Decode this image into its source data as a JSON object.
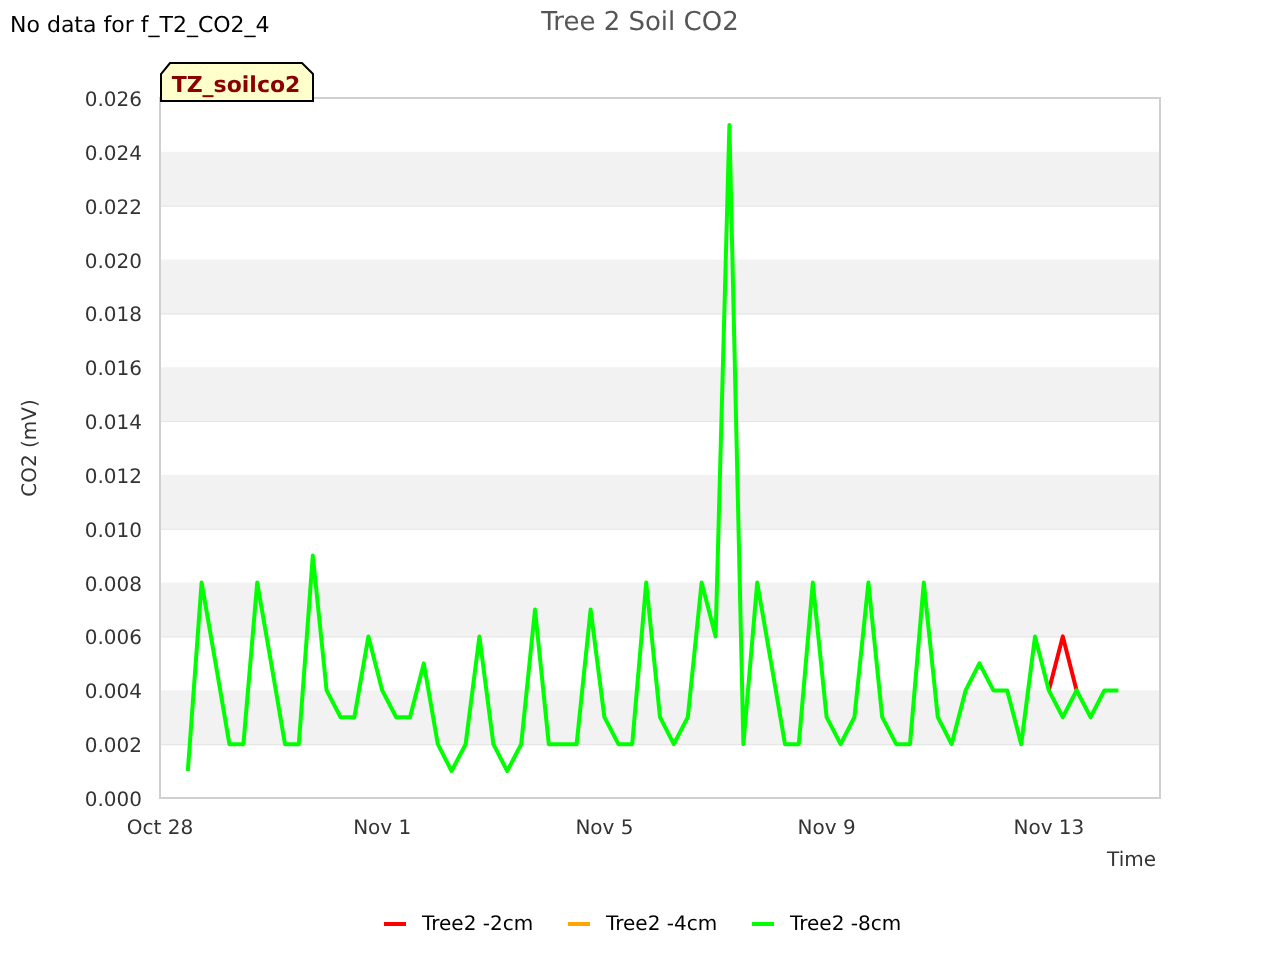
{
  "status_text": "No data for f_T2_CO2_4",
  "chart": {
    "tag": "TZ_soilco2",
    "chart_data": {
      "type": "line",
      "title": "Tree 2 Soil CO2",
      "xlabel": "Time",
      "ylabel": "CO2 (mV)",
      "grid": true,
      "legend": "bottom",
      "ylim": [
        0,
        0.026
      ],
      "yticks": [
        {
          "value": 0,
          "label": "0.000"
        },
        {
          "value": 0.002,
          "label": "0.002"
        },
        {
          "value": 0.004,
          "label": "0.004"
        },
        {
          "value": 0.006,
          "label": "0.006"
        },
        {
          "value": 0.008,
          "label": "0.008"
        },
        {
          "value": 0.01,
          "label": "0.010"
        },
        {
          "value": 0.012,
          "label": "0.012"
        },
        {
          "value": 0.014,
          "label": "0.014"
        },
        {
          "value": 0.016,
          "label": "0.016"
        },
        {
          "value": 0.018,
          "label": "0.018"
        },
        {
          "value": 0.02,
          "label": "0.020"
        },
        {
          "value": 0.022,
          "label": "0.022"
        },
        {
          "value": 0.024,
          "label": "0.024"
        },
        {
          "value": 0.026,
          "label": "0.026"
        }
      ],
      "categories": [
        "Oct 28",
        null,
        null,
        null,
        null,
        null,
        null,
        null,
        null,
        null,
        null,
        null,
        null,
        null,
        null,
        null,
        "Nov 1",
        null,
        null,
        null,
        null,
        null,
        null,
        null,
        null,
        null,
        null,
        null,
        null,
        null,
        null,
        null,
        "Nov 5",
        null,
        null,
        null,
        null,
        null,
        null,
        null,
        null,
        null,
        null,
        null,
        null,
        null,
        null,
        null,
        "Nov 9",
        null,
        null,
        null,
        null,
        null,
        null,
        null,
        null,
        null,
        null,
        null,
        null,
        null,
        null,
        null,
        "Nov 13",
        null,
        null,
        null,
        null,
        null,
        null,
        null,
        null
      ],
      "series": [
        {
          "name": "Tree2 -2cm",
          "color": "#ff0000",
          "values": [
            null,
            null,
            null,
            null,
            null,
            null,
            null,
            null,
            null,
            null,
            null,
            null,
            null,
            null,
            null,
            null,
            null,
            null,
            null,
            null,
            null,
            null,
            null,
            null,
            null,
            null,
            null,
            null,
            null,
            null,
            null,
            null,
            null,
            null,
            null,
            null,
            null,
            null,
            null,
            null,
            null,
            null,
            null,
            null,
            null,
            null,
            null,
            null,
            null,
            null,
            null,
            null,
            null,
            null,
            null,
            null,
            null,
            null,
            null,
            null,
            null,
            null,
            null,
            null,
            0.004,
            0.006,
            0.004,
            null,
            null,
            null,
            null,
            null,
            null
          ]
        },
        {
          "name": "Tree2 -4cm",
          "color": "#ffa500",
          "values": [
            null,
            null,
            null,
            null,
            null,
            null,
            null,
            null,
            null,
            null,
            null,
            null,
            null,
            null,
            null,
            null,
            null,
            null,
            null,
            null,
            null,
            null,
            null,
            null,
            null,
            null,
            null,
            null,
            null,
            null,
            null,
            null,
            null,
            null,
            null,
            null,
            null,
            null,
            null,
            null,
            null,
            null,
            null,
            null,
            null,
            null,
            null,
            null,
            null,
            null,
            null,
            null,
            null,
            null,
            null,
            null,
            null,
            null,
            null,
            null,
            null,
            null,
            null,
            null,
            null,
            null,
            null,
            null,
            null,
            null,
            null,
            null,
            null
          ]
        },
        {
          "name": "Tree2 -8cm",
          "color": "#00ff00",
          "values": [
            null,
            null,
            0.001,
            0.008,
            0.005,
            0.002,
            0.002,
            0.008,
            0.005,
            0.002,
            0.002,
            0.009,
            0.004,
            0.003,
            0.003,
            0.006,
            0.004,
            0.003,
            0.003,
            0.005,
            0.002,
            0.001,
            0.002,
            0.006,
            0.002,
            0.001,
            0.002,
            0.007,
            0.002,
            0.002,
            0.002,
            0.007,
            0.003,
            0.002,
            0.002,
            0.008,
            0.003,
            0.002,
            0.003,
            0.008,
            0.006,
            0.025,
            0.002,
            0.008,
            0.005,
            0.002,
            0.002,
            0.008,
            0.003,
            0.002,
            0.003,
            0.008,
            0.003,
            0.002,
            0.002,
            0.008,
            0.003,
            0.002,
            0.004,
            0.005,
            0.004,
            0.004,
            0.002,
            0.006,
            0.004,
            0.003,
            0.004,
            0.003,
            0.004,
            0.004,
            null,
            null,
            null
          ]
        }
      ]
    }
  }
}
